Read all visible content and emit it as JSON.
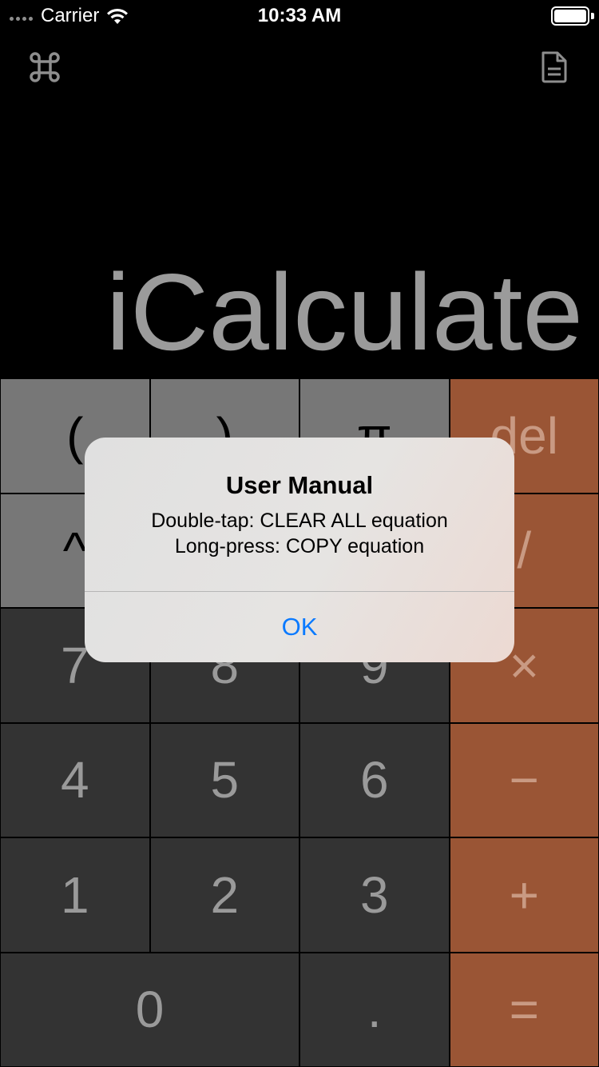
{
  "status_bar": {
    "carrier": "Carrier",
    "time": "10:33 AM",
    "wifi_icon": "wifi-icon",
    "battery_icon": "battery-icon"
  },
  "toolbar": {
    "left_icon": "command-icon",
    "right_icon": "document-icon"
  },
  "display": {
    "text": "iCalculate"
  },
  "keypad": {
    "row1": [
      "(",
      ")",
      "π",
      "del"
    ],
    "row2": [
      "^",
      "",
      "",
      "/"
    ],
    "row3": [
      "7",
      "8",
      "9",
      "×"
    ],
    "row4": [
      "4",
      "5",
      "6",
      "−"
    ],
    "row5": [
      "1",
      "2",
      "3",
      "+"
    ],
    "row6": [
      "0",
      ".",
      "="
    ]
  },
  "alert": {
    "title": "User Manual",
    "line1": "Double-tap: CLEAR ALL equation",
    "line2": "Long-press: COPY equation",
    "ok_label": "OK"
  },
  "colors": {
    "function_key": "#777777",
    "number_key": "#333333",
    "operator_key": "#9a5535",
    "alert_button": "#0a7aff"
  }
}
